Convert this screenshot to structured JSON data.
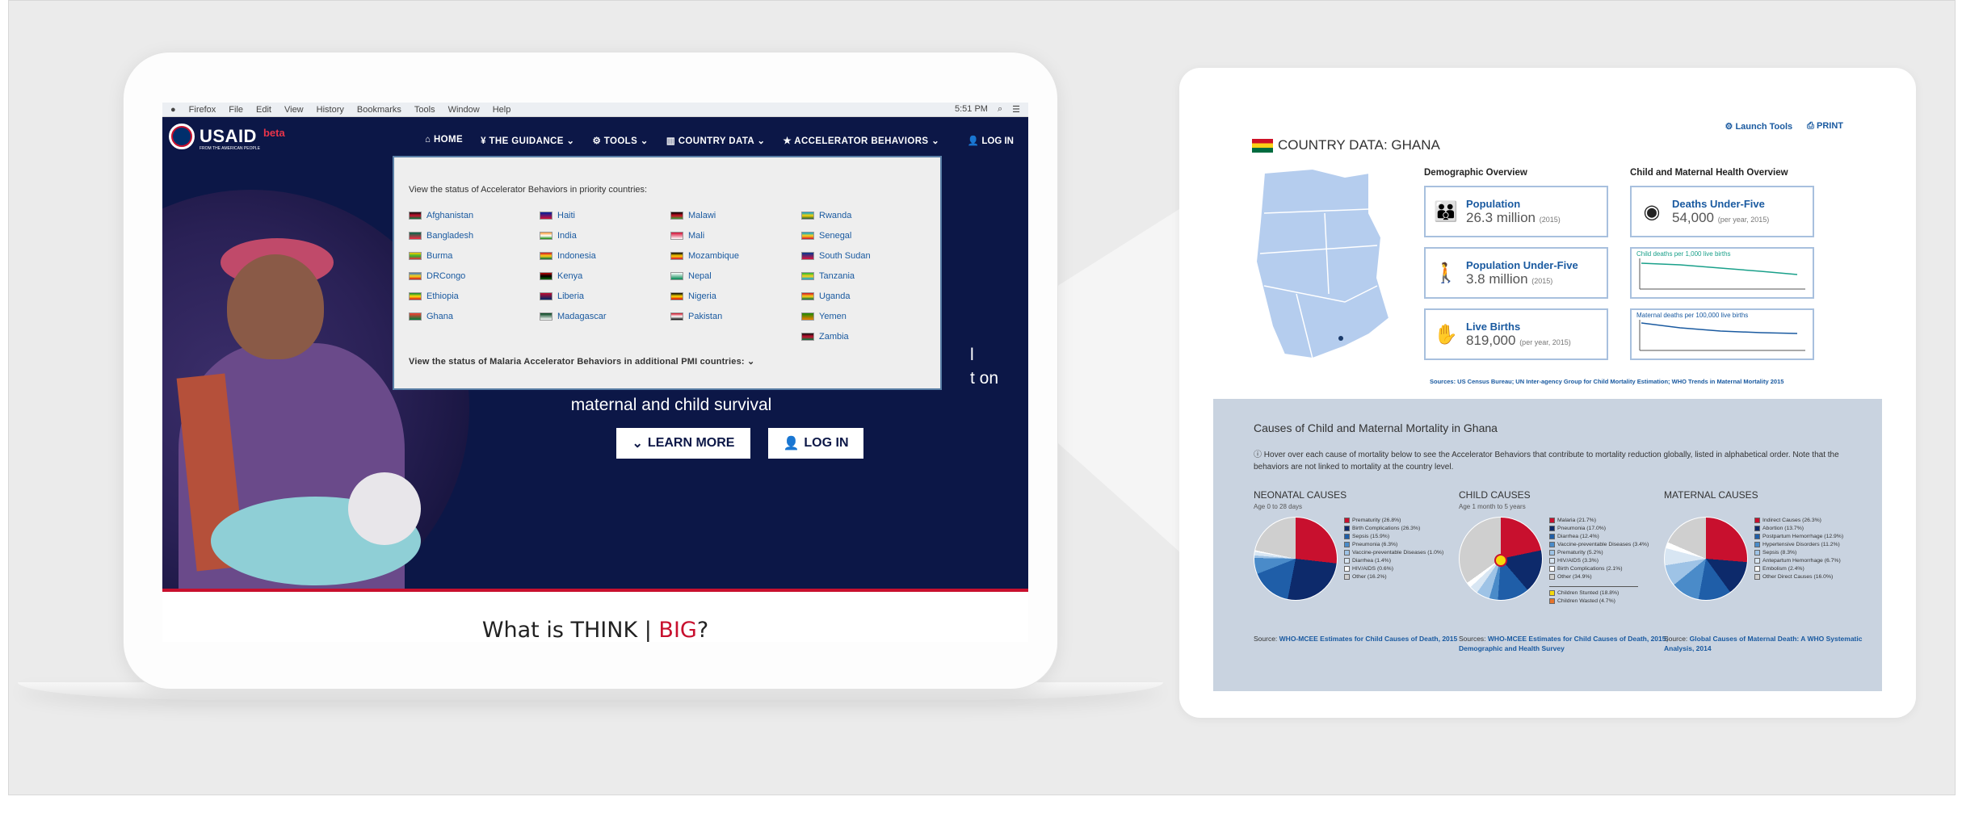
{
  "menubar": {
    "apple": "",
    "items": [
      "Firefox",
      "File",
      "Edit",
      "View",
      "History",
      "Bookmarks",
      "Tools",
      "Window",
      "Help"
    ],
    "time": "5:51 PM"
  },
  "site": {
    "logo": "USAID",
    "logo_sub": "FROM THE AMERICAN PEOPLE",
    "beta": "beta",
    "nav": [
      "HOME",
      "THE GUIDANCE",
      "TOOLS",
      "COUNTRY DATA",
      "ACCELERATOR BEHAVIORS"
    ],
    "login": "LOG IN",
    "dropdown_intro": "View the status of Accelerator Behaviors in priority countries:",
    "countries": [
      [
        "Afghanistan",
        "Haiti",
        "Malawi",
        "Rwanda"
      ],
      [
        "Bangladesh",
        "India",
        "Mali",
        "Senegal"
      ],
      [
        "Burma",
        "Indonesia",
        "Mozambique",
        "South Sudan"
      ],
      [
        "DRCongo",
        "Kenya",
        "Nepal",
        "Tanzania"
      ],
      [
        "Ethiopia",
        "Liberia",
        "Nigeria",
        "Uganda"
      ],
      [
        "Ghana",
        "Madagascar",
        "Pakistan",
        "Yemen"
      ],
      [
        "",
        "",
        "",
        "Zambia"
      ]
    ],
    "dropdown_more": "View the status of Malaria Accelerator Behaviors in additional PMI countries:",
    "hero_line": "maternal and child survival",
    "hero_frag1": "l",
    "hero_frag2": "t on",
    "learn_more": "LEARN MORE",
    "login_btn": "LOG IN",
    "below_heading_a": "What is THINK | ",
    "below_heading_b": "BIG",
    "below_heading_c": "?"
  },
  "card": {
    "launch": "Launch Tools",
    "print": "PRINT",
    "title": "COUNTRY DATA: GHANA",
    "demo_h": "Demographic Overview",
    "health_h": "Child and Maternal Health Overview",
    "stats": [
      {
        "label": "Population",
        "value": "26.3 million",
        "note": "(2015)"
      },
      {
        "label": "Population Under-Five",
        "value": "3.8 million",
        "note": "(2015)"
      },
      {
        "label": "Live Births",
        "value": "819,000",
        "note": "(per year, 2015)"
      }
    ],
    "deaths_label": "Deaths Under-Five",
    "deaths_value": "54,000",
    "deaths_note": "(per year, 2015)",
    "chart1_title": "Child deaths per 1,000 live births",
    "chart2_title": "Maternal deaths per 100,000 live births",
    "sources": "Sources: US Census Bureau; UN Inter-agency Group for Child Mortality Estimation; WHO Trends in Maternal Mortality 2015",
    "mort_title": "Causes of Child and Maternal Mortality in Ghana",
    "mort_note": "Hover over each cause of mortality below to see the Accelerator Behaviors that contribute to mortality reduction globally, listed in alphabetical order. Note that the behaviors are not linked to mortality at the country level.",
    "neonatal": {
      "h": "NEONATAL CAUSES",
      "sub": "Age 0 to 28 days",
      "legend": [
        "Prematurity (26.8%)",
        "Birth Complications (26.3%)",
        "Sepsis (15.9%)",
        "Pneumonia (6.3%)",
        "Vaccine-preventable Diseases (1.0%)",
        "Diarrhea (1.4%)",
        "HIV/AIDS (0.6%)",
        "Other (16.2%)"
      ],
      "src_a": "Source: ",
      "src_b": "WHO-MCEE Estimates for Child Causes of Death, 2015"
    },
    "child": {
      "h": "CHILD CAUSES",
      "sub": "Age 1 month to 5 years",
      "legend": [
        "Malaria (21.7%)",
        "Pneumonia (17.0%)",
        "Diarrhea (12.4%)",
        "Vaccine-preventable Diseases (3.4%)",
        "Prematurity (5.2%)",
        "HIV/AIDS (3.3%)",
        "Birth Complications (2.1%)",
        "Other (34.9%)"
      ],
      "legend2": [
        "Children Stunted (18.8%)",
        "Children Wasted (4.7%)"
      ],
      "src_a": "Sources: ",
      "src_b": "WHO-MCEE Estimates for Child Causes of Death, 2015; Demographic and Health Survey"
    },
    "maternal": {
      "h": "MATERNAL CAUSES",
      "sub": "",
      "legend": [
        "Indirect Causes (26.3%)",
        "Abortion (13.7%)",
        "Postpartum Hemorrhage (12.9%)",
        "Hypertensive Disorders (11.2%)",
        "Sepsis (8.3%)",
        "Antepartum Hemorrhage (6.7%)",
        "Embolism (2.4%)",
        "Other Direct Causes (16.0%)"
      ],
      "src_a": "Source: ",
      "src_b": "Global Causes of Maternal Death: A WHO Systematic Analysis, 2014"
    }
  },
  "colors": {
    "navy": "#0c1747",
    "red": "#c8102e",
    "link": "#1a5aa0",
    "panel": "#c9d3e0"
  }
}
